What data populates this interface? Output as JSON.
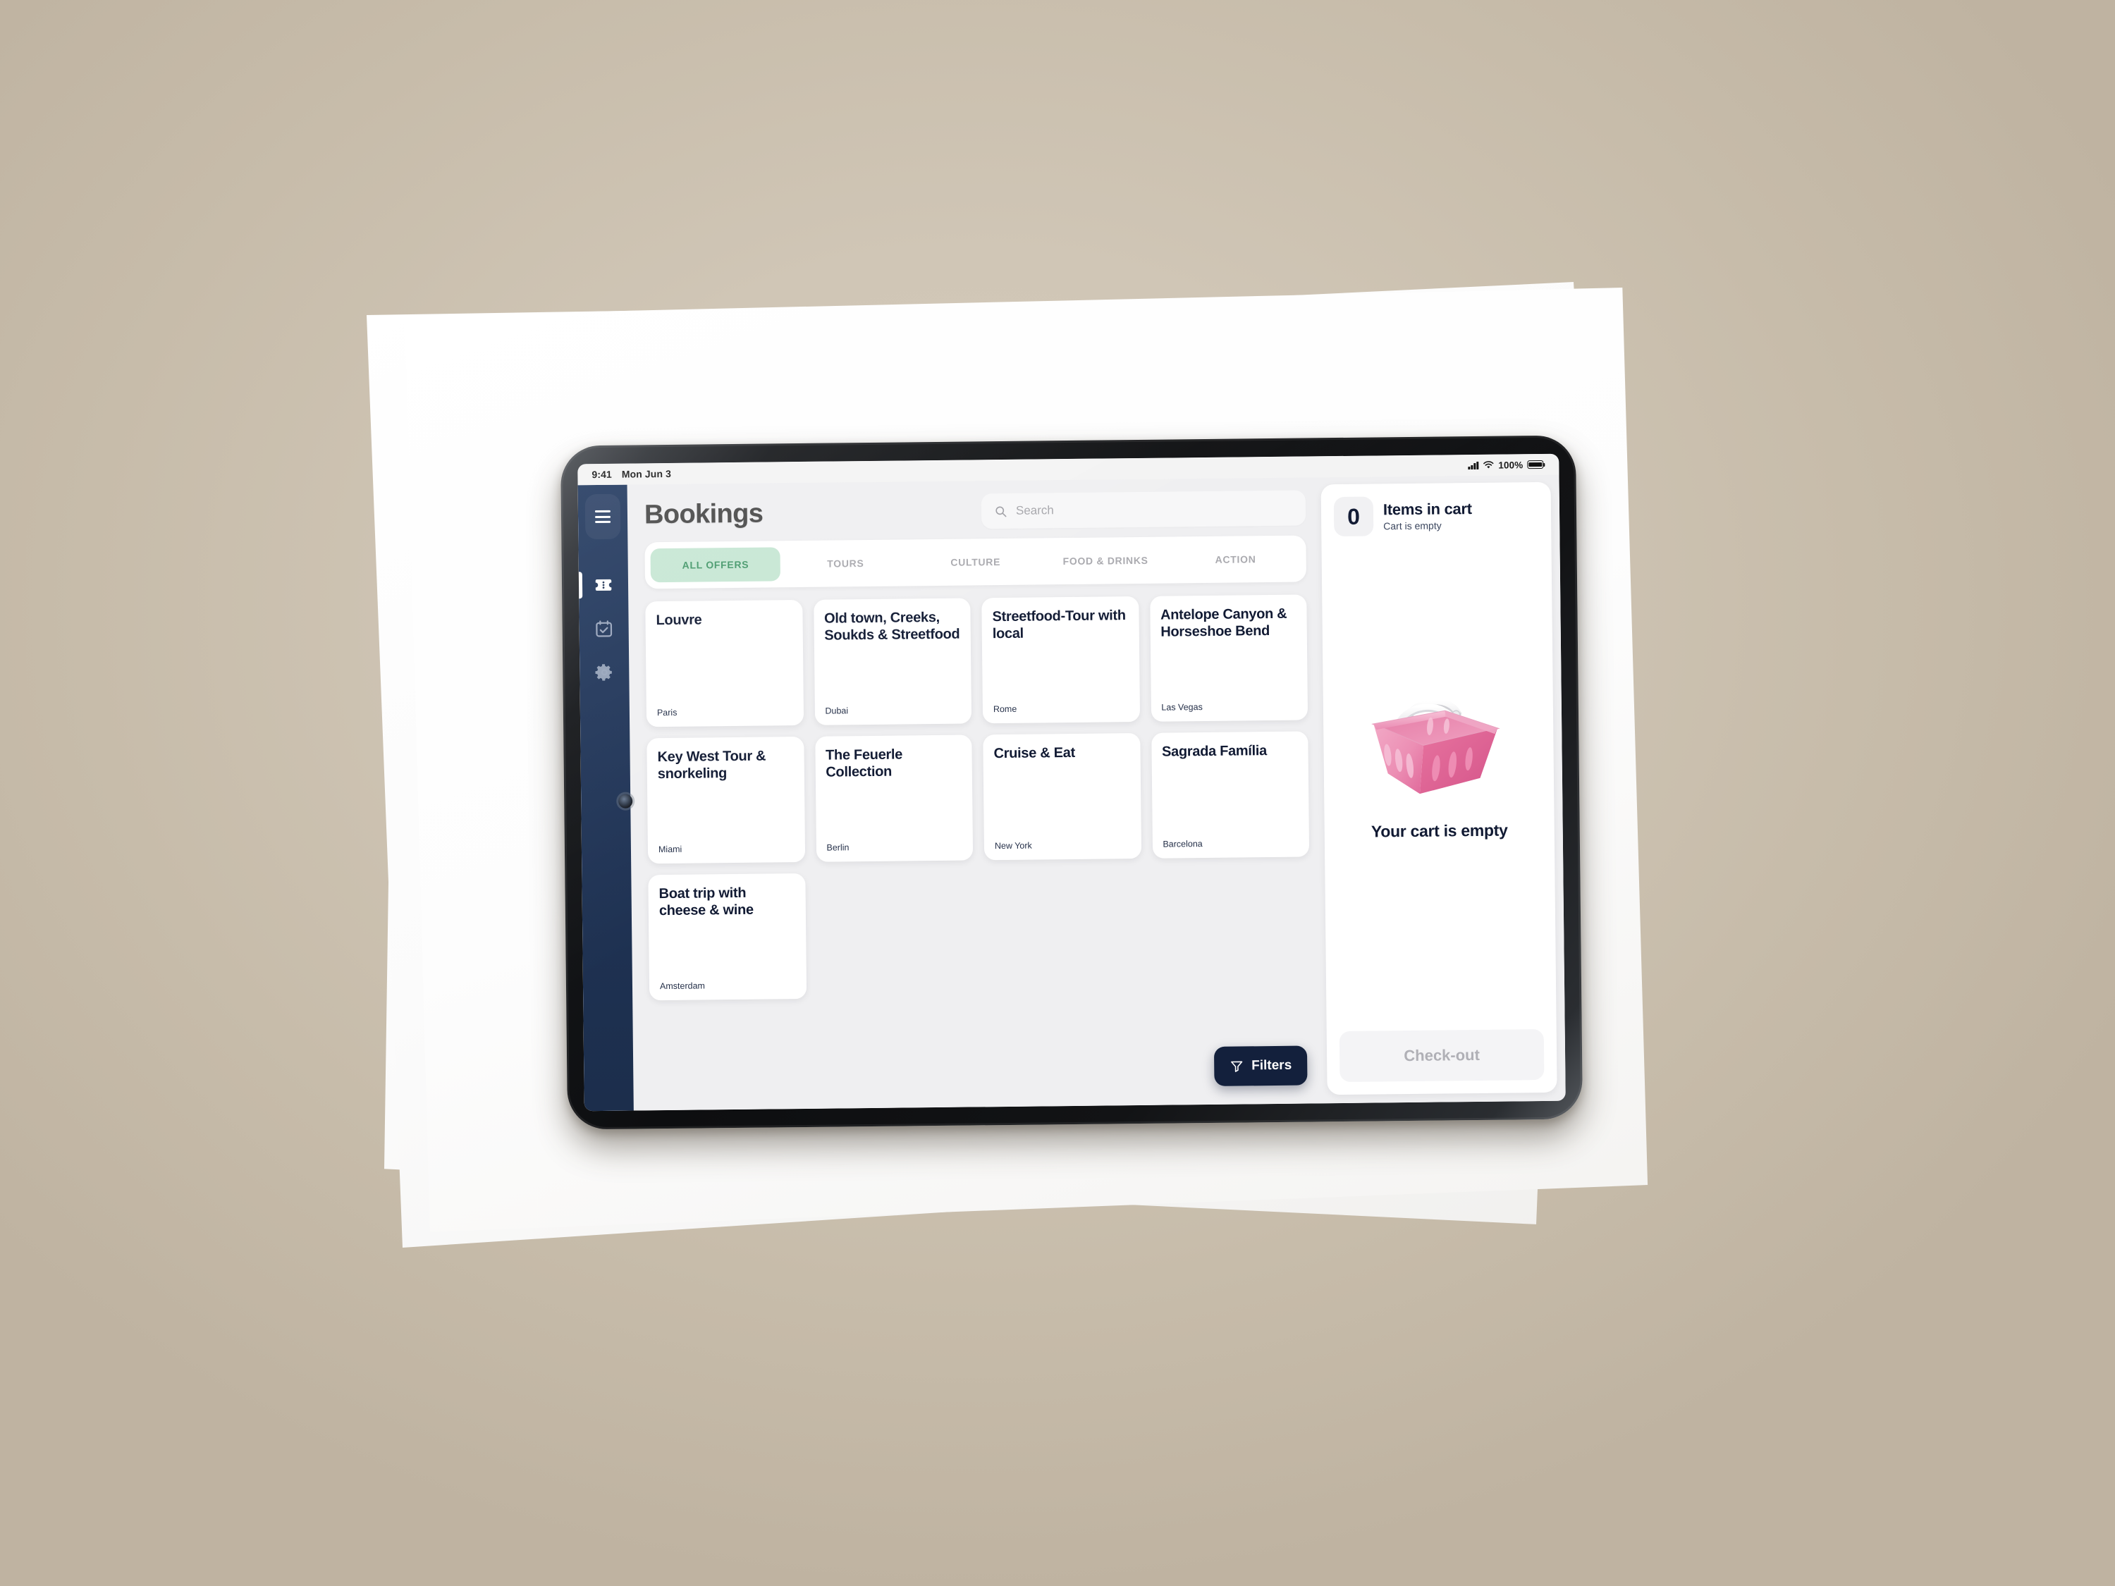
{
  "statusbar": {
    "time": "9:41",
    "date": "Mon Jun 3",
    "battery_percent": "100%"
  },
  "sidebar": {
    "items": [
      {
        "name": "menu",
        "icon": "hamburger-icon",
        "label": "Menu"
      },
      {
        "name": "tickets",
        "icon": "ticket-icon",
        "label": "Tickets",
        "active": true
      },
      {
        "name": "calendar",
        "icon": "calendar-check-icon",
        "label": "Calendar",
        "active": false
      },
      {
        "name": "settings",
        "icon": "gear-icon",
        "label": "Settings",
        "active": false
      }
    ]
  },
  "header": {
    "title": "Bookings"
  },
  "search": {
    "placeholder": "Search",
    "value": "",
    "icon": "search-icon"
  },
  "tabs": [
    {
      "label": "ALL OFFERS",
      "active": true
    },
    {
      "label": "TOURS",
      "active": false
    },
    {
      "label": "CULTURE",
      "active": false
    },
    {
      "label": "FOOD & DRINKS",
      "active": false
    },
    {
      "label": "ACTION",
      "active": false
    }
  ],
  "offers": [
    {
      "title": "Louvre",
      "city": "Paris"
    },
    {
      "title": "Old town, Creeks, Soukds & Streetfood",
      "city": "Dubai"
    },
    {
      "title": "Streetfood-Tour with local",
      "city": "Rome"
    },
    {
      "title": "Antelope Canyon & Horseshoe Bend",
      "city": "Las Vegas"
    },
    {
      "title": "Key West Tour & snorkeling",
      "city": "Miami"
    },
    {
      "title": "The Feuerle Collection",
      "city": "Berlin"
    },
    {
      "title": "Cruise & Eat",
      "city": "New York"
    },
    {
      "title": "Sagrada Família",
      "city": "Barcelona"
    },
    {
      "title": "Boat trip with cheese & wine",
      "city": "Amsterdam"
    }
  ],
  "filters": {
    "label": "Filters",
    "icon": "funnel-icon"
  },
  "cart": {
    "count": "0",
    "title": "Items in cart",
    "subtitle": "Cart is empty",
    "empty_illustration": "shopping-basket-illustration",
    "empty_text": "Your cart is empty",
    "checkout_label": "Check-out",
    "checkout_disabled": true
  },
  "colors": {
    "sidebar": "#1f3355",
    "accent_navy": "#13203c",
    "tab_active_bg": "#c7e7d4",
    "tab_active_text": "#47996c",
    "card_title": "#111a33",
    "basket_pink": "#e8689c",
    "background": "#cdc3b3"
  }
}
